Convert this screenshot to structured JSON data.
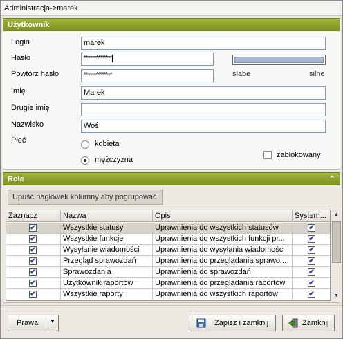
{
  "window": {
    "title": "Administracja->marek"
  },
  "user_panel": {
    "header": "Użytkownik",
    "login_label": "Login",
    "login_value": "marek",
    "password_label": "Hasło",
    "password_value": "**************",
    "repeat_password_label": "Powtórz hasło",
    "repeat_password_value": "**************",
    "strength_weak": "słabe",
    "strength_strong": "silne",
    "strength_level": 1.0,
    "first_name_label": "Imię",
    "first_name_value": "Marek",
    "second_name_label": "Drugie imię",
    "second_name_value": "",
    "surname_label": "Nazwisko",
    "surname_value": "Woś",
    "gender_label": "Płeć",
    "gender_female": "kobieta",
    "gender_male": "mężczyzna",
    "gender_selected": "mężczyzna",
    "blocked_label": "zablokowany",
    "blocked_checked": false
  },
  "role_panel": {
    "header": "Role",
    "collapse_icon": "double-chevron-up-icon",
    "group_hint": "Upuść nagłówek kolumny aby pogrupować",
    "columns": [
      "Zaznacz",
      "Nazwa",
      "Opis",
      "System..."
    ],
    "rows": [
      {
        "checked": true,
        "name": "Wszystkie statusy",
        "desc": "Uprawnienia do wszystkich statusów",
        "system": true,
        "selected": true
      },
      {
        "checked": true,
        "name": "Wszystkie funkcje",
        "desc": "Uprawnienia do wszystkich funkcji pr...",
        "system": true,
        "selected": false
      },
      {
        "checked": true,
        "name": "Wysyłanie wiadomości",
        "desc": "Uprawnienia do wysyłania wiadomości",
        "system": true,
        "selected": false
      },
      {
        "checked": true,
        "name": "Przegląd sprawozdań",
        "desc": "Uprawnienia do przeglądania sprawo...",
        "system": true,
        "selected": false
      },
      {
        "checked": true,
        "name": "Sprawozdania",
        "desc": "Uprawnienia do sprawozdań",
        "system": true,
        "selected": false
      },
      {
        "checked": true,
        "name": "Użytkownik raportów",
        "desc": "Uprawnienia do przeglądania raportów",
        "system": true,
        "selected": false
      },
      {
        "checked": true,
        "name": "Wszystkie raporty",
        "desc": "Uprawnienia do wszystkich raportów",
        "system": true,
        "selected": false
      }
    ]
  },
  "footer": {
    "rights_button": "Prawa",
    "save_close_button": "Zapisz i zamknij",
    "close_button": "Zamknij"
  },
  "colors": {
    "header_green": "#8ca12b",
    "selected_row": "#d6d3cb",
    "checkmark": "#1c3a8a"
  }
}
